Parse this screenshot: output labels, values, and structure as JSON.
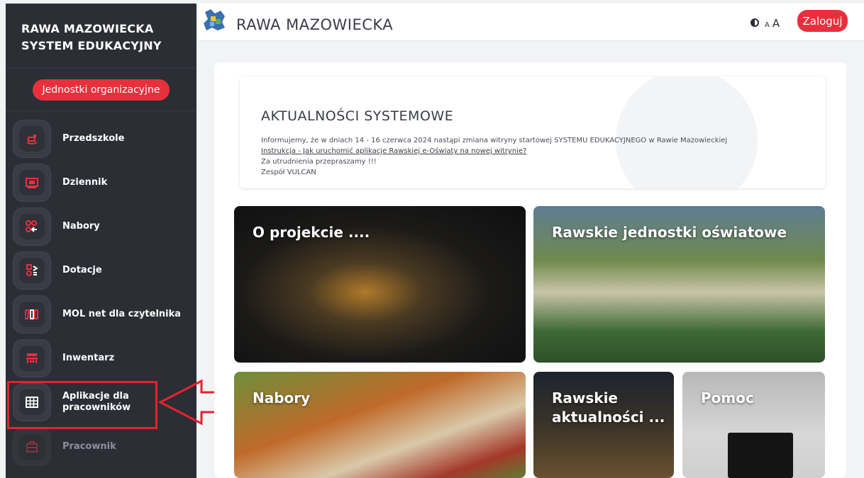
{
  "sidebar": {
    "brand_line1": "RAWA MAZOWIECKA",
    "brand_line2": "SYSTEM EDUKACYJNY",
    "units_button": "Jednostki organizacyjne",
    "items": [
      {
        "label": "Przedszkole",
        "icon": "rocking-horse-icon"
      },
      {
        "label": "Dziennik",
        "icon": "gradebook-icon"
      },
      {
        "label": "Nabory",
        "icon": "enrollment-icon"
      },
      {
        "label": "Dotacje",
        "icon": "grants-icon"
      },
      {
        "label": "MOL net dla czytelnika",
        "icon": "books-icon"
      },
      {
        "label": "Inwentarz",
        "icon": "desk-icon"
      },
      {
        "label": "Aplikacje dla pracowników",
        "icon": "grid-icon"
      },
      {
        "label": "Pracownik",
        "icon": "briefcase-icon"
      }
    ]
  },
  "header": {
    "title": "RAWA MAZOWIECKA",
    "font_small": "A",
    "font_large": "A",
    "login": "Zaloguj"
  },
  "news": {
    "title": "AKTUALNOŚCI SYSTEMOWE",
    "line1": "Informujemy, że w dniach 14 - 16 czerwca 2024 nastąpi zmiana witryny startowej SYSTEMU EDUKACYJNEGO w Rawie Mazowieckiej",
    "link": "Instrukcja - Jak uruchomić aplikacje Rawskiej e-Oświaty na nowej witrynie?",
    "line3": "Za utrudnienia przepraszamy !!!",
    "line4": "Zespół VULCAN"
  },
  "tiles": {
    "projekt": "O projekcie ....",
    "jednostki": "Rawskie jednostki oświatowe",
    "nabory": "Nabory",
    "aktualnosci": "Rawskie aktualności ...",
    "pomoc": "Pomoc"
  },
  "colors": {
    "accent": "#e8303d",
    "sidebar_bg": "#2c2e36",
    "annotation": "#e2232e"
  }
}
